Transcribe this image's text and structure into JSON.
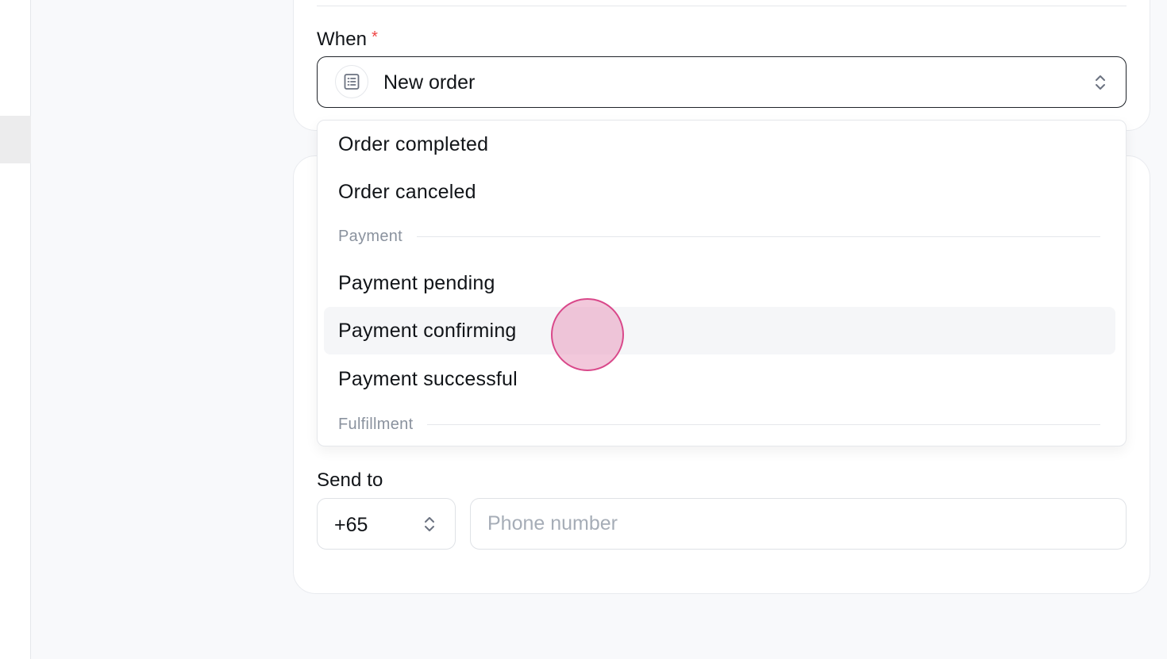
{
  "form": {
    "when_label": "When",
    "required_mark": "*",
    "when_value": "New order",
    "when_icon": "list-icon",
    "send_to_label": "Send to",
    "country_code": "+65",
    "phone_placeholder": "Phone number"
  },
  "dropdown": {
    "items": [
      {
        "type": "option",
        "label": "Order completed"
      },
      {
        "type": "option",
        "label": "Order canceled"
      },
      {
        "type": "group",
        "label": "Payment"
      },
      {
        "type": "option",
        "label": "Payment pending"
      },
      {
        "type": "option",
        "label": "Payment confirming",
        "hovered": true
      },
      {
        "type": "option",
        "label": "Payment successful"
      },
      {
        "type": "group",
        "label": "Fulfillment"
      }
    ]
  },
  "colors": {
    "required": "#ef4444",
    "cursor_highlight": "#d9488a",
    "page_background": "#f8f9fb"
  }
}
